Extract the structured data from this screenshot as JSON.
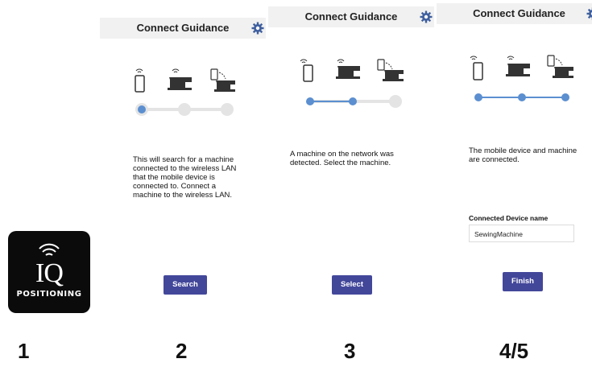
{
  "app_icon": {
    "logo": "IQ",
    "subtitle": "POSITIONING",
    "icon_name": "wireless-signal-icon"
  },
  "steps": [
    "1",
    "2",
    "3",
    "4/5"
  ],
  "screens": [
    {
      "title": "Connect Guidance",
      "message": "This will search for a machine connected to the wireless LAN that the mobile device is connected to. Connect a machine to the wireless LAN.",
      "button": "Search",
      "progress_step": 1
    },
    {
      "title": "Connect Guidance",
      "message": "A machine on the network was detected. Select the machine.",
      "button": "Select",
      "progress_step": 2
    },
    {
      "title": "Connect Guidance",
      "message": "The mobile device and machine are connected.",
      "field_label": "Connected Device name",
      "field_value": "SewingMachine",
      "button": "Finish",
      "progress_step": 3
    }
  ],
  "colors": {
    "accent": "#43479a",
    "progress_active": "#5b8fd0",
    "progress_inactive": "#e4e4e4",
    "gear": "#3f5f9e"
  }
}
